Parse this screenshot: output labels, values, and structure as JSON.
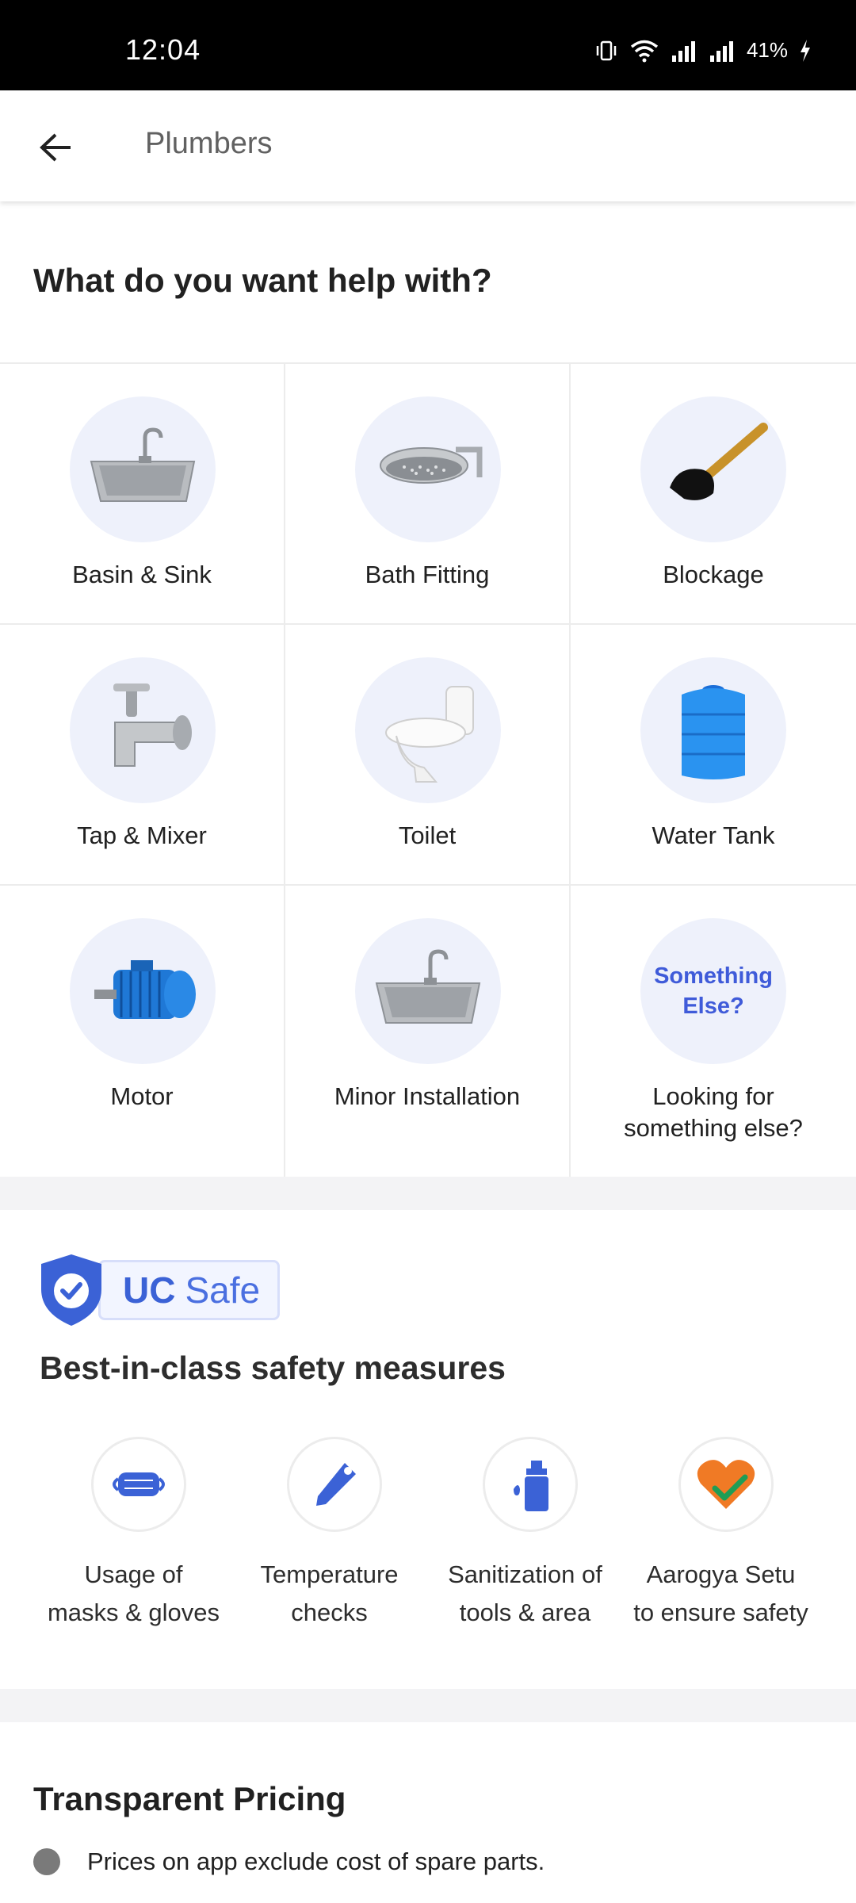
{
  "status_bar": {
    "time": "12:04",
    "battery": "41%"
  },
  "app_bar": {
    "title": "Plumbers"
  },
  "help": {
    "heading": "What do you want help with?",
    "items": [
      {
        "label": "Basin & Sink",
        "icon": "sink-icon"
      },
      {
        "label": "Bath Fitting",
        "icon": "shower-head-icon"
      },
      {
        "label": "Blockage",
        "icon": "plunger-icon"
      },
      {
        "label": "Tap & Mixer",
        "icon": "tap-icon"
      },
      {
        "label": "Toilet",
        "icon": "toilet-icon"
      },
      {
        "label": "Water Tank",
        "icon": "water-tank-icon"
      },
      {
        "label": "Motor",
        "icon": "motor-icon"
      },
      {
        "label": "Minor Installation",
        "icon": "sink-icon"
      },
      {
        "label_line1": "Looking for",
        "label_line2": "something else?",
        "icon_text_line1": "Something",
        "icon_text_line2": "Else?"
      }
    ]
  },
  "safety": {
    "badge_uc": "UC",
    "badge_safe": "Safe",
    "heading": "Best-in-class safety measures",
    "measures": [
      {
        "line1": "Usage of",
        "line2": "masks & gloves",
        "icon": "mask-icon"
      },
      {
        "line1": "Temperature",
        "line2": "checks",
        "icon": "thermometer-icon"
      },
      {
        "line1": "Sanitization of",
        "line2": "tools & area",
        "icon": "sanitizer-icon"
      },
      {
        "line1": "Aarogya Setu",
        "line2": "to ensure safety",
        "icon": "heart-check-icon"
      }
    ]
  },
  "pricing": {
    "heading": "Transparent Pricing",
    "items": [
      "Prices on app exclude cost of spare parts."
    ]
  },
  "colors": {
    "accent_blue": "#3f5bd9",
    "icon_circle_bg": "#eef1fb",
    "status_bar": "#000000"
  }
}
